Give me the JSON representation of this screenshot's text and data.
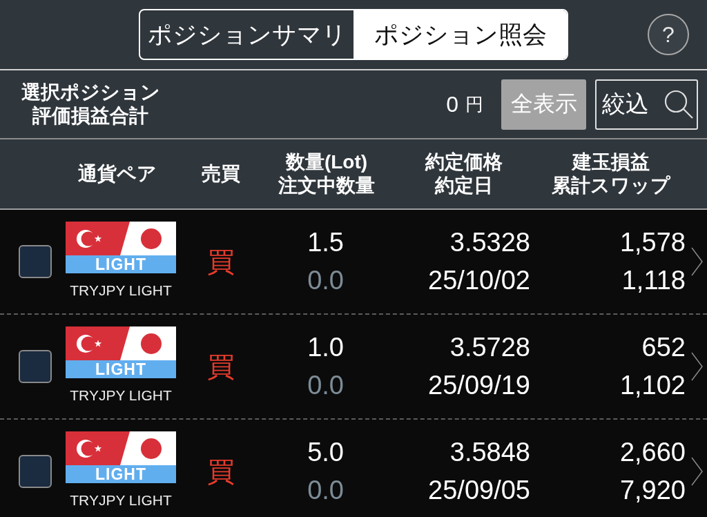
{
  "tabs": [
    {
      "label": "ポジションサマリ",
      "selected": false
    },
    {
      "label": "ポジション照会",
      "selected": true
    }
  ],
  "help_button": "?",
  "summary": {
    "label": [
      "選択ポジション",
      "評価損益合計"
    ],
    "value": "0",
    "unit": "円"
  },
  "actions": [
    {
      "label": "全表示",
      "kind": "show_all"
    },
    {
      "label": "絞込",
      "kind": "filter"
    }
  ],
  "table": {
    "columns": [
      {
        "lines": [
          "通貨ペア"
        ]
      },
      {
        "lines": [
          "売買"
        ]
      },
      {
        "lines": [
          "数量(Lot)",
          "注文中数量"
        ]
      },
      {
        "lines": [
          "約定価格",
          "約定日"
        ]
      },
      {
        "lines": [
          "建玉損益",
          "累計スワップ"
        ]
      }
    ],
    "rows": [
      {
        "checked": false,
        "tag": "LIGHT",
        "pair": "TRYJPY LIGHT",
        "side": "買",
        "quantity": "1.5",
        "order_quantity": "0.0",
        "price": "3.5328",
        "date": "25/10/02",
        "pnl": "1,578",
        "swap": "1,118"
      },
      {
        "checked": false,
        "tag": "LIGHT",
        "pair": "TRYJPY LIGHT",
        "side": "買",
        "quantity": "1.0",
        "order_quantity": "0.0",
        "price": "3.5728",
        "date": "25/09/19",
        "pnl": "652",
        "swap": "1,102"
      },
      {
        "checked": false,
        "tag": "LIGHT",
        "pair": "TRYJPY LIGHT",
        "side": "買",
        "quantity": "5.0",
        "order_quantity": "0.0",
        "price": "3.5848",
        "date": "25/09/05",
        "pnl": "2,660",
        "swap": "7,920"
      }
    ]
  }
}
